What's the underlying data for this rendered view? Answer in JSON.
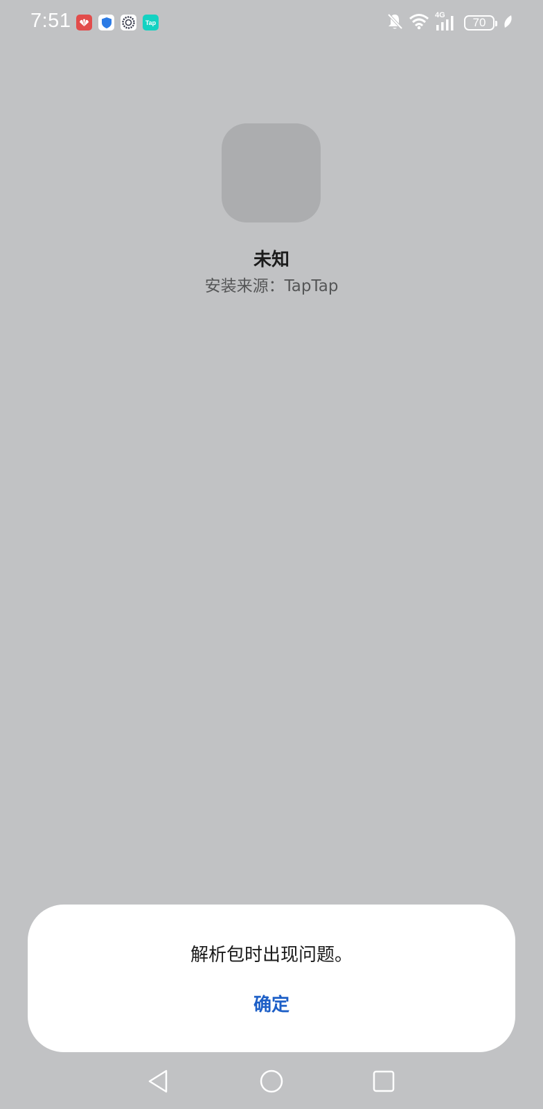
{
  "status_bar": {
    "time": "7:51",
    "notification_icons": [
      "huawei-app-icon",
      "shield-icon",
      "gear-icon",
      "taptap-icon"
    ],
    "taptap_label": "Tap",
    "network": "4G",
    "battery_level": "70",
    "status_icons": [
      "bell-muted-icon",
      "wifi-icon",
      "signal-4g-icon",
      "battery-icon",
      "leaf-icon"
    ]
  },
  "app": {
    "name": "未知",
    "source": "安装来源：TapTap"
  },
  "dialog": {
    "message": "解析包时出现问题。",
    "confirm_label": "确定",
    "confirm_color": "#1d5fc7"
  },
  "nav_bar": {
    "buttons": [
      "back-icon",
      "home-icon",
      "recent-apps-icon"
    ]
  }
}
